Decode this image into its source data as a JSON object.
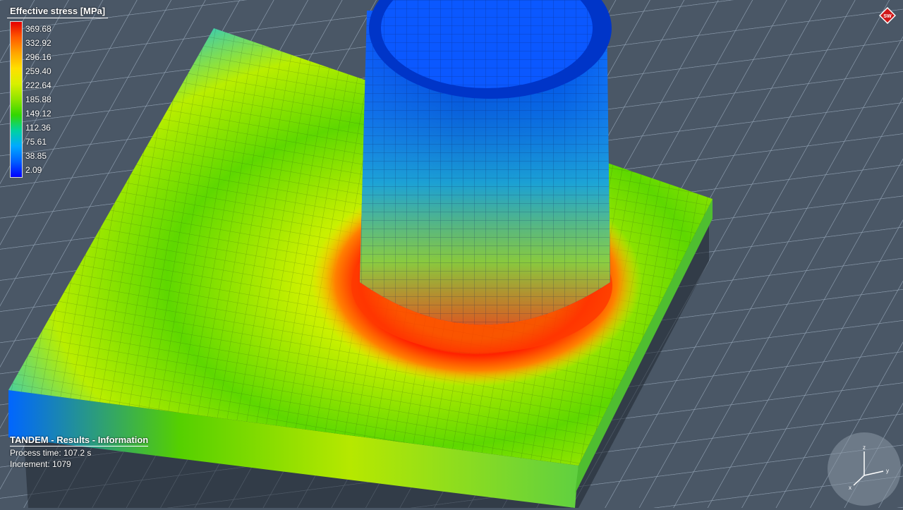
{
  "legend": {
    "title": "Effective stress [MPa]",
    "values": [
      "369.68",
      "332.92",
      "296.16",
      "259.40",
      "222.64",
      "185.88",
      "149.12",
      "112.36",
      "75.61",
      "38.85",
      "2.09"
    ]
  },
  "info": {
    "title": "TANDEM - Results - Information",
    "process_time": "Process time: 107.2 s",
    "increment": "Increment: 1079"
  },
  "colors": {
    "background": "#4a5766",
    "max_stress": "#e60000",
    "min_stress": "#0000ff"
  },
  "icons": {
    "logo": "sw-logo-icon",
    "triad": "axis-triad-icon"
  }
}
